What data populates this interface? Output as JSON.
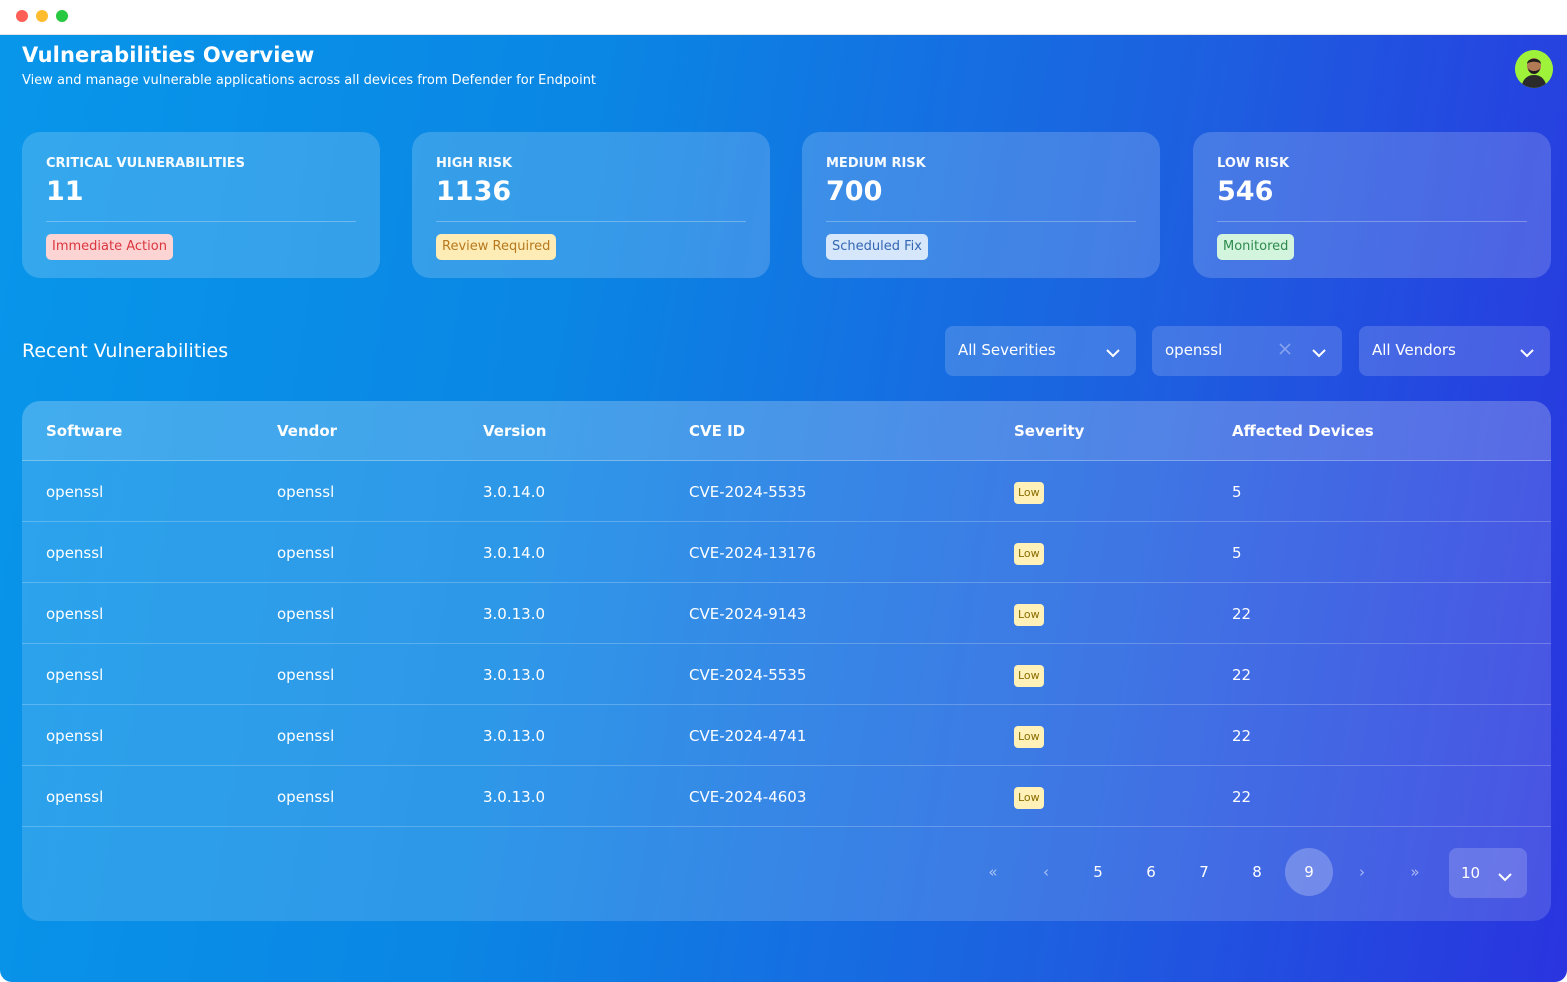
{
  "header": {
    "title": "Vulnerabilities Overview",
    "subtitle": "View and manage vulnerable applications across all devices from Defender for Endpoint"
  },
  "stats": [
    {
      "label": "CRITICAL VULNERABILITIES",
      "value": "11",
      "badge": "Immediate Action",
      "badge_bg": "#fdd4d4",
      "badge_color": "#d9363e"
    },
    {
      "label": "HIGH RISK",
      "value": "1136",
      "badge": "Review Required",
      "badge_bg": "#fdecb5",
      "badge_color": "#b7791f"
    },
    {
      "label": "MEDIUM RISK",
      "value": "700",
      "badge": "Scheduled Fix",
      "badge_bg": "#d6e6fb",
      "badge_color": "#3366b3"
    },
    {
      "label": "LOW RISK",
      "value": "546",
      "badge": "Monitored",
      "badge_bg": "#d3f4dd",
      "badge_color": "#2e8b4e"
    }
  ],
  "section": {
    "title": "Recent Vulnerabilities"
  },
  "filters": {
    "severity": "All Severities",
    "search": "openssl",
    "vendor": "All Vendors"
  },
  "table": {
    "columns": [
      "Software",
      "Vendor",
      "Version",
      "CVE ID",
      "Severity",
      "Affected Devices"
    ],
    "rows": [
      {
        "software": "openssl",
        "vendor": "openssl",
        "version": "3.0.14.0",
        "cve": "CVE-2024-5535",
        "severity": "Low",
        "devices": "5"
      },
      {
        "software": "openssl",
        "vendor": "openssl",
        "version": "3.0.14.0",
        "cve": "CVE-2024-13176",
        "severity": "Low",
        "devices": "5"
      },
      {
        "software": "openssl",
        "vendor": "openssl",
        "version": "3.0.13.0",
        "cve": "CVE-2024-9143",
        "severity": "Low",
        "devices": "22"
      },
      {
        "software": "openssl",
        "vendor": "openssl",
        "version": "3.0.13.0",
        "cve": "CVE-2024-5535",
        "severity": "Low",
        "devices": "22"
      },
      {
        "software": "openssl",
        "vendor": "openssl",
        "version": "3.0.13.0",
        "cve": "CVE-2024-4741",
        "severity": "Low",
        "devices": "22"
      },
      {
        "software": "openssl",
        "vendor": "openssl",
        "version": "3.0.13.0",
        "cve": "CVE-2024-4603",
        "severity": "Low",
        "devices": "22"
      }
    ]
  },
  "pagination": {
    "first": "«",
    "prev": "‹",
    "pages": [
      "5",
      "6",
      "7",
      "8",
      "9"
    ],
    "current": "9",
    "next": "›",
    "last": "»",
    "page_size": "10"
  },
  "icons": {
    "chevron": "chevron-down-icon",
    "clear": "close-icon",
    "avatar": "user-avatar"
  },
  "colors": {
    "gradient_start": "#0896ea",
    "gradient_end": "#2a34df",
    "severity_low_bg": "#fff1b8",
    "severity_low_text": "#8a6d00"
  }
}
